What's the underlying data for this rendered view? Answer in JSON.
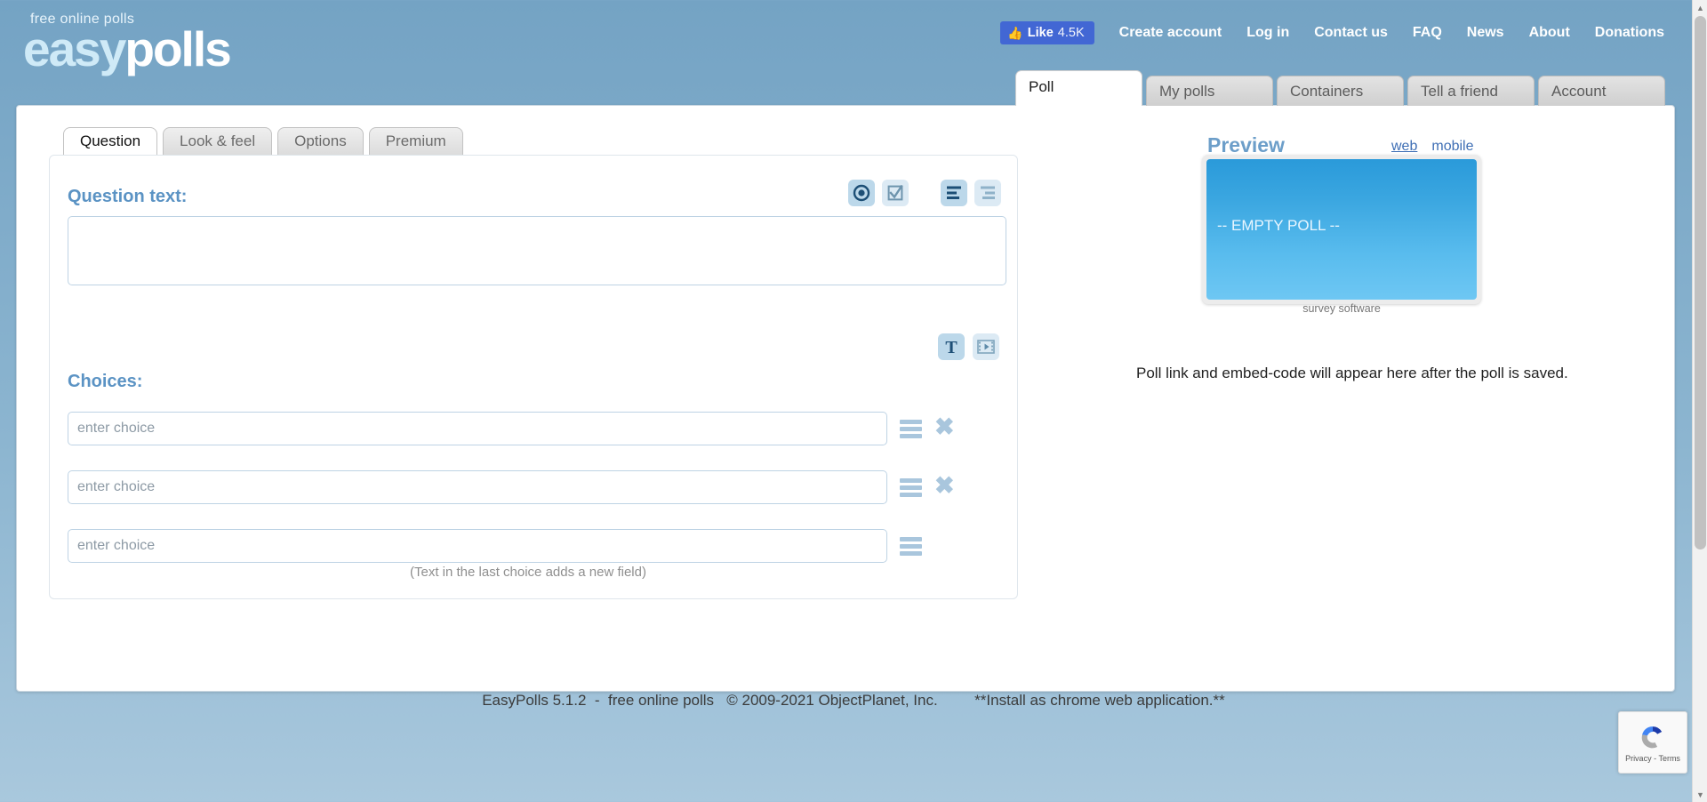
{
  "brand": {
    "tagline": "free online polls",
    "name_part1": "easy",
    "name_part2": "polls"
  },
  "topnav": {
    "facebook": {
      "icon": "thumbs-up-icon",
      "label": "Like",
      "count": "4.5K"
    },
    "links": [
      "Create account",
      "Log in",
      "Contact us",
      "FAQ",
      "News",
      "About",
      "Donations"
    ]
  },
  "main_tabs": [
    {
      "label": "Poll",
      "active": true
    },
    {
      "label": "My polls",
      "active": false
    },
    {
      "label": "Containers",
      "active": false
    },
    {
      "label": "Tell a friend",
      "active": false
    },
    {
      "label": "Account",
      "active": false
    }
  ],
  "sub_tabs": [
    {
      "label": "Question",
      "active": true
    },
    {
      "label": "Look & feel",
      "active": false
    },
    {
      "label": "Options",
      "active": false
    },
    {
      "label": "Premium",
      "active": false
    }
  ],
  "form": {
    "question_label": "Question text:",
    "question_value": "",
    "question_placeholder": "",
    "question_type_icons": [
      {
        "name": "radio-button-icon",
        "state": "on"
      },
      {
        "name": "checkbox-icon",
        "state": "off"
      },
      {
        "name": "align-left-icon",
        "state": "on"
      },
      {
        "name": "align-right-icon",
        "state": "off"
      }
    ],
    "choices_label": "Choices:",
    "choice_type_icons": [
      {
        "name": "text-type-icon",
        "state": "on"
      },
      {
        "name": "media-type-icon",
        "state": "off"
      }
    ],
    "choices": [
      {
        "placeholder": "enter choice",
        "value": "",
        "deletable": true
      },
      {
        "placeholder": "enter choice",
        "value": "",
        "deletable": true
      },
      {
        "placeholder": "enter choice",
        "value": "",
        "deletable": false
      }
    ],
    "hint": "(Text in the last choice adds a new field)"
  },
  "preview": {
    "title": "Preview",
    "modes": [
      {
        "label": "web",
        "selected": true
      },
      {
        "label": "mobile",
        "selected": false
      }
    ],
    "empty_text": "-- EMPTY POLL --",
    "caption": "survey software",
    "note": "Poll link and embed-code will appear here after the poll is saved.",
    "gradient_top": "#2a9ada",
    "gradient_bottom": "#6ec7f3"
  },
  "footer": {
    "product": "EasyPolls 5.1.2",
    "dash": "-",
    "subtitle": "free online polls",
    "copyright": "© 2009-2021 ObjectPlanet, Inc.",
    "install_note": "**Install as chrome web application.**"
  },
  "recaptcha": {
    "privacy": "Privacy",
    "sep": "-",
    "terms": "Terms"
  },
  "colors": {
    "page_bg": "#7ba7c7",
    "label_blue": "#5b93c4",
    "facebook_blue": "#4267d4",
    "icon_on": "#bcd8ea",
    "icon_off": "#dceaf4"
  }
}
